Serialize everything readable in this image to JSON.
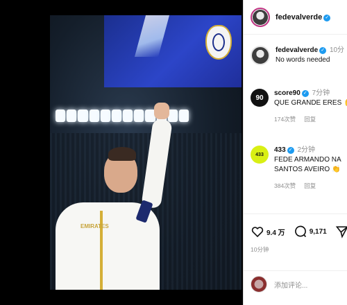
{
  "post": {
    "author": "fedevalverde",
    "caption": "No words needed",
    "caption_time": "10分",
    "likes": "9.4 万",
    "comments_count": "9,171",
    "posted_time": "10分钟",
    "add_comment_placeholder": "添加评论..."
  },
  "comments": [
    {
      "user": "score90",
      "avatar_text": "90",
      "time": "7分钟",
      "text": "QUE GRANDE ERES ✋",
      "likes": "174次赞",
      "reply_label": "回复"
    },
    {
      "user": "433",
      "avatar_text": "433",
      "time": "2分钟",
      "text_line1": "FEDE ARMANDO NA",
      "text_line2": "SANTOS AVEIRO 👏",
      "likes": "384次赞",
      "reply_label": "回复"
    }
  ],
  "photo": {
    "shirt_text": "EMIRATES"
  },
  "icons": {
    "like": "heart-icon",
    "comment": "comment-icon",
    "share": "send-icon",
    "verified": "verified-badge-icon"
  },
  "colors": {
    "verified": "#1d9bf0",
    "muted_text": "#8e8e8e",
    "brand_blue": "#2c45c8",
    "highlight_433": "#d9ef14"
  }
}
